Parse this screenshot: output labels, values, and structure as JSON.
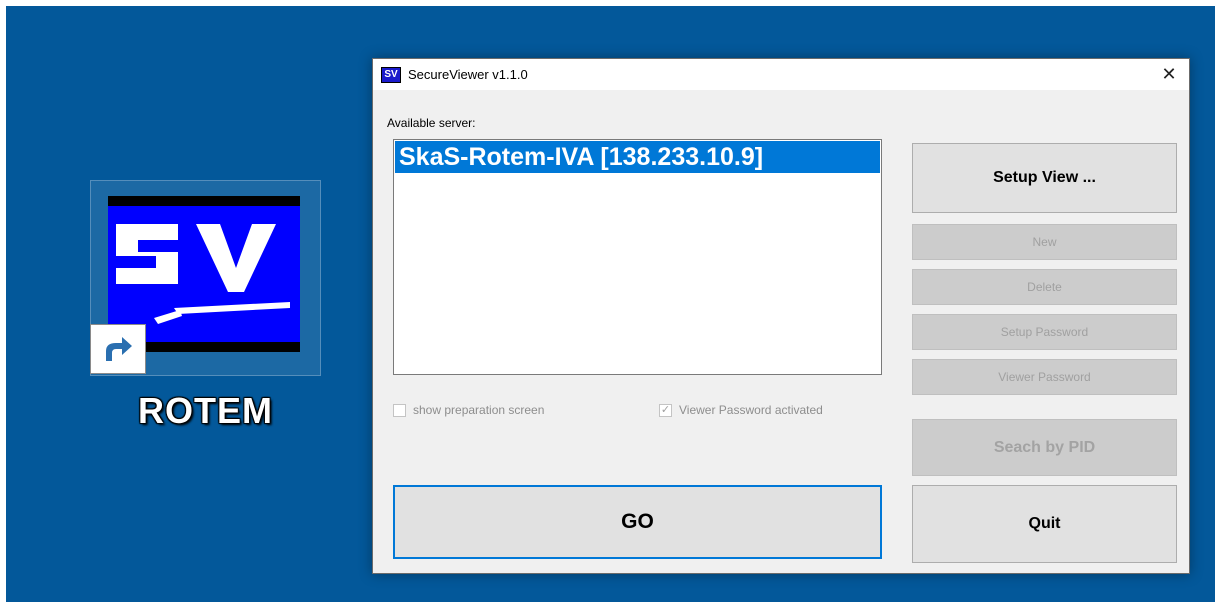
{
  "desktop": {
    "background": "#03589a",
    "icon": {
      "label": "ROTEM",
      "logo_icon": "sv-logo-icon",
      "badge_icon": "shortcut-arrow-icon"
    }
  },
  "window": {
    "title": "SecureViewer v1.1.0",
    "app_icon": "sv-app-icon",
    "close_icon": "close-icon",
    "available_label": "Available server:",
    "servers": [
      {
        "name": "SkaS-Rotem-IVA [138.233.10.9]",
        "selected": true
      }
    ],
    "checkboxes": {
      "preparation": {
        "label": "show preparation screen",
        "checked": false,
        "enabled": false
      },
      "viewer_password": {
        "label": "Viewer Password activated",
        "checked": true,
        "enabled": false
      }
    },
    "buttons": {
      "setup_view": "Setup View ...",
      "new": "New",
      "delete": "Delete",
      "setup_password": "Setup Password",
      "viewer_password": "Viewer Password",
      "search_pid": "Seach by PID",
      "go": "GO",
      "quit": "Quit"
    },
    "accent": "#0078d7"
  }
}
